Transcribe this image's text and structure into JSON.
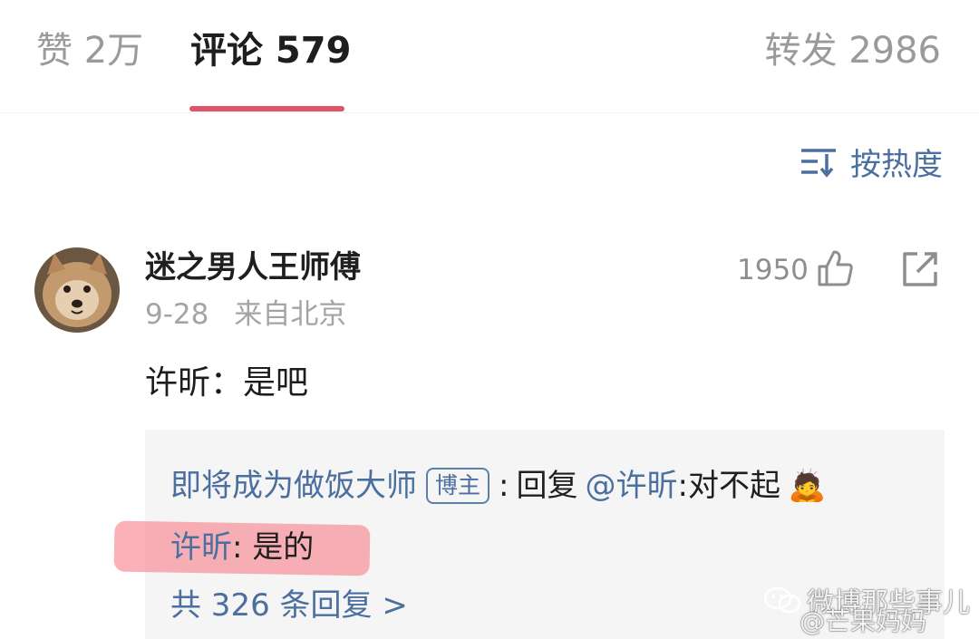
{
  "tabs": {
    "likes": "赞 2万",
    "comments": "评论 579",
    "reposts": "转发 2986"
  },
  "sort": {
    "label": "按热度",
    "icon": "sort-icon"
  },
  "comment": {
    "user": "迷之男人王师傅",
    "date": "9-28",
    "location": "来自北京",
    "likes": "1950",
    "text": "许昕：是吧"
  },
  "reply": {
    "author": "即将成为做饭大师",
    "badge": "博主",
    "separator": ":",
    "reply_word": "回复",
    "mention": "@许昕",
    "mention_colon": ":",
    "content": "对不起",
    "emoji": "🙇",
    "second_user": "许昕",
    "second_text": ": 是的",
    "more": "共 326 条回复 >"
  },
  "watermark": {
    "line1": "微博那些事儿",
    "line2": "@芒果妈妈"
  },
  "colors": {
    "accent": "#e0546a",
    "link": "#4b6f9f",
    "highlight": "#f5737d"
  }
}
